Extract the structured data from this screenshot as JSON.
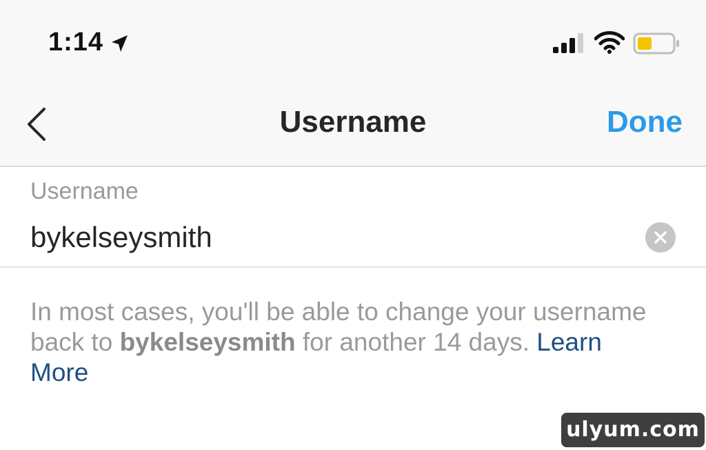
{
  "status_bar": {
    "time": "1:14",
    "icons": [
      "location-arrow-icon",
      "cellular-signal-icon",
      "wifi-icon",
      "battery-icon"
    ],
    "battery_color": "#f5c400"
  },
  "nav": {
    "title": "Username",
    "back_icon": "chevron-left-icon",
    "done_label": "Done",
    "done_color": "#2b9ae8"
  },
  "username_field": {
    "label": "Username",
    "value": "bykelseysmith",
    "clear_icon": "clear-x-icon"
  },
  "info": {
    "text_before": "In most cases, you'll be able to change your username back to ",
    "username": "bykelseysmith",
    "text_after": " for another 14 days. ",
    "learn_more": "Learn More",
    "link_color": "#1f4f82"
  },
  "watermark": {
    "text": "ulyum.com"
  }
}
